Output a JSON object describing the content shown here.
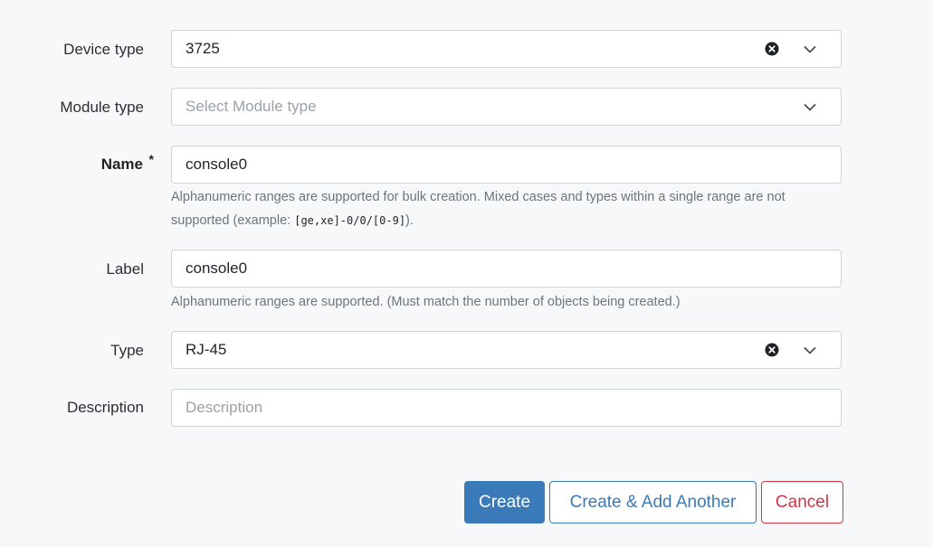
{
  "form": {
    "device_type": {
      "label": "Device type",
      "value": "3725",
      "clear_icon": "clear-circle-icon",
      "dropdown_icon": "chevron-down-icon"
    },
    "module_type": {
      "label": "Module type",
      "placeholder": "Select Module type",
      "dropdown_icon": "chevron-down-icon"
    },
    "name": {
      "label": "Name",
      "required_marker": "*",
      "value": "console0",
      "help_text_before": "Alphanumeric ranges are supported for bulk creation. Mixed cases and types within a single range are not supported (example: ",
      "help_code": "[ge,xe]-0/0/[0-9]",
      "help_text_after": ")."
    },
    "label": {
      "label": "Label",
      "value": "console0",
      "help_text": "Alphanumeric ranges are supported. (Must match the number of objects being created.)"
    },
    "type": {
      "label": "Type",
      "value": "RJ-45",
      "clear_icon": "clear-circle-icon",
      "dropdown_icon": "chevron-down-icon"
    },
    "description": {
      "label": "Description",
      "placeholder": "Description"
    }
  },
  "actions": {
    "create": "Create",
    "create_add_another": "Create & Add Another",
    "cancel": "Cancel"
  },
  "colors": {
    "primary": "#3a7ab8",
    "danger": "#d63447",
    "background": "#f6f8fa",
    "help_text": "#6c757d"
  }
}
